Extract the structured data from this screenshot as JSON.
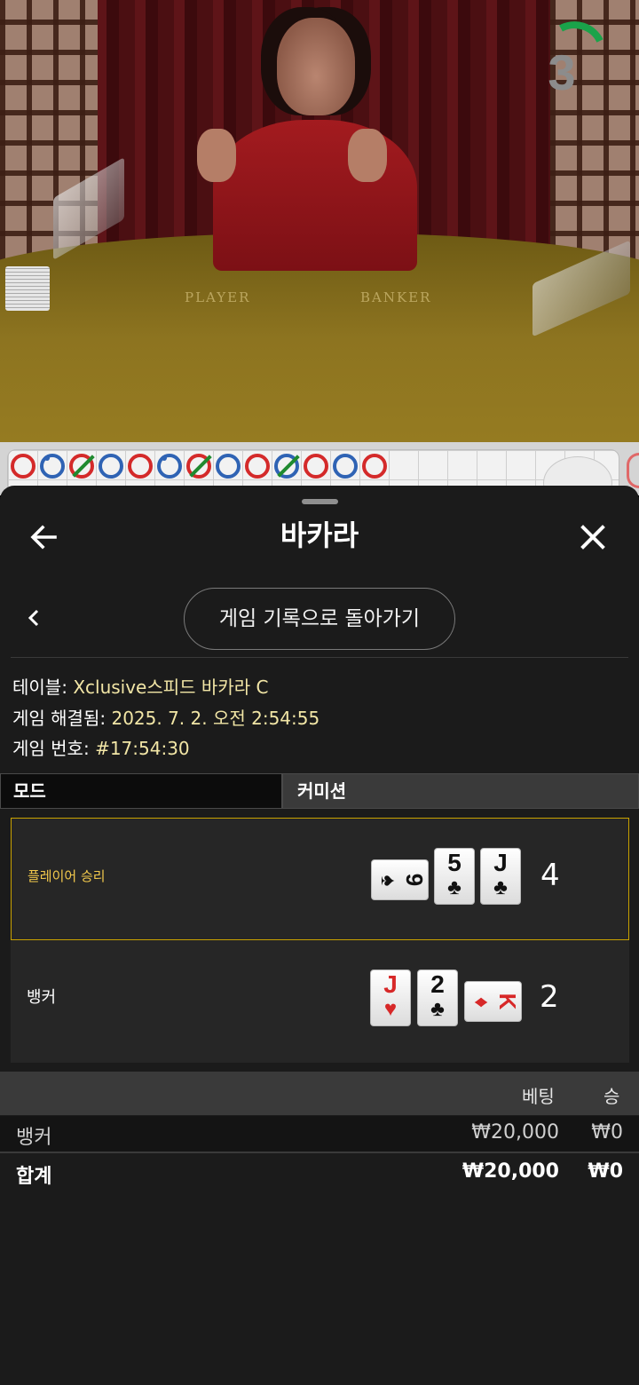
{
  "video": {
    "felt_player": "PLAYER",
    "felt_banker": "BANKER",
    "countdown": "3",
    "colors": {
      "timer_arc": "#1aa34a"
    }
  },
  "roadmap": {
    "beads": [
      "red",
      "blue-dot",
      "green",
      "blue",
      "red",
      "blue-dot",
      "green",
      "blue",
      "red",
      "green",
      "red",
      "blue",
      "red"
    ]
  },
  "sheet": {
    "title": "바카라",
    "back_icon": "arrow-left-icon",
    "close_icon": "close-icon",
    "return_button": "게임 기록으로 돌아가기",
    "info": {
      "table_label": "테이블:",
      "table_value": "Xclusive스피드 바카라 C",
      "resolved_label": "게임 해결됨:",
      "resolved_value": "2025. 7. 2. 오전 2:54:55",
      "game_no_label": "게임 번호:",
      "game_no_value": "#17:54:30"
    },
    "tabs": {
      "mode": "모드",
      "commission": "커미션"
    },
    "result": {
      "player": {
        "label": "플레이어 승리",
        "score": "4",
        "cards": [
          {
            "rank": "9",
            "suit": "♠",
            "color": "black",
            "orientation": "side"
          },
          {
            "rank": "5",
            "suit": "♣",
            "color": "black",
            "orientation": "up"
          },
          {
            "rank": "J",
            "suit": "♣",
            "color": "black",
            "orientation": "up"
          }
        ]
      },
      "banker": {
        "label": "뱅커",
        "score": "2",
        "cards": [
          {
            "rank": "J",
            "suit": "♥",
            "color": "red",
            "orientation": "up"
          },
          {
            "rank": "2",
            "suit": "♣",
            "color": "black",
            "orientation": "up"
          },
          {
            "rank": "K",
            "suit": "♦",
            "color": "red",
            "orientation": "side"
          }
        ]
      }
    },
    "bets": {
      "header": {
        "bet": "베팅",
        "win": "승"
      },
      "rows": [
        {
          "name": "뱅커",
          "bet": "₩20,000",
          "win": "₩0"
        }
      ],
      "total": {
        "name": "합계",
        "bet": "₩20,000",
        "win": "₩0"
      }
    },
    "colors": {
      "win_highlight": "#c9a200",
      "info_value": "#f2e6a6"
    }
  }
}
